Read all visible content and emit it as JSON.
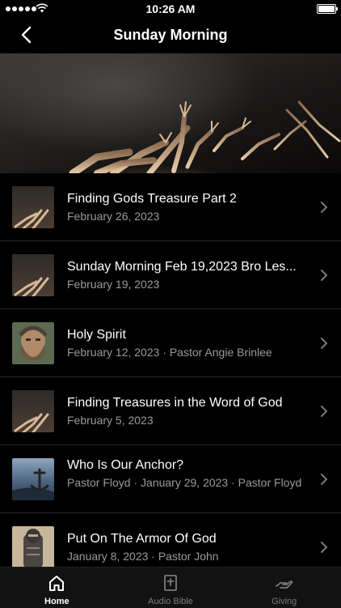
{
  "status_bar": {
    "time": "10:26 AM",
    "signal_bars": 5,
    "battery": "full"
  },
  "nav": {
    "title": "Sunday Morning",
    "back_icon": "chevron-left-icon"
  },
  "hero": {
    "image": "worship-raised-hands-photo"
  },
  "sermons": [
    {
      "title": "Finding Gods Treasure Part 2",
      "subtitle": "February 26, 2023",
      "thumbnail": "raised-hands"
    },
    {
      "title": "Sunday Morning Feb 19,2023 Bro Les...",
      "subtitle": "February 19, 2023",
      "thumbnail": "raised-hands"
    },
    {
      "title": "Holy Spirit",
      "subtitle": "February 12, 2023 · Pastor Angie Brinlee",
      "thumbnail": "bearded-man-portrait"
    },
    {
      "title": "Finding Treasures in the Word of God",
      "subtitle": "February 5, 2023",
      "thumbnail": "raised-hands"
    },
    {
      "title": "Who Is Our Anchor?",
      "subtitle": "Pastor Floyd · January 29, 2023 · Pastor Floyd",
      "thumbnail": "anchor-seascape"
    },
    {
      "title": "Put On The Armor Of God",
      "subtitle": "January 8, 2023 · Pastor John",
      "thumbnail": "knight-armor"
    }
  ],
  "tabs": [
    {
      "label": "Home",
      "icon": "home-icon",
      "active": true
    },
    {
      "label": "Audio Bible",
      "icon": "bible-icon",
      "active": false
    },
    {
      "label": "Giving",
      "icon": "giving-hand-icon",
      "active": false
    }
  ],
  "colors": {
    "background": "#000000",
    "tab_bar": "#121212",
    "subtitle": "#9a9a9a",
    "separator": "#2a2a2a"
  }
}
